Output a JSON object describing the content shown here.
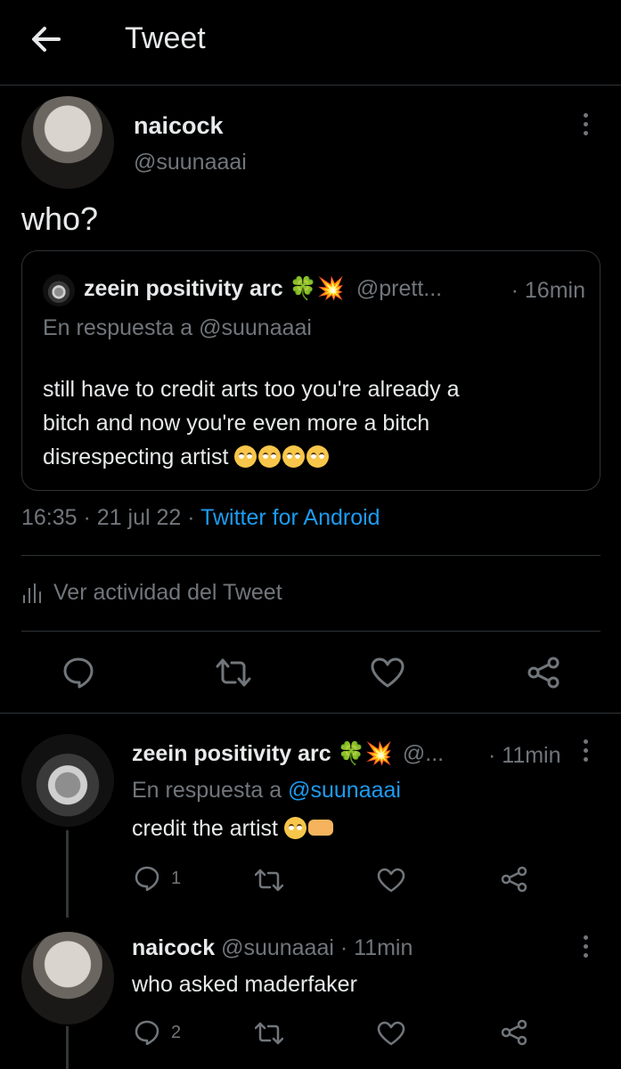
{
  "header": {
    "title": "Tweet"
  },
  "main_tweet": {
    "display_name": "naicock",
    "handle": "@suunaaai",
    "text": "who?",
    "quote": {
      "display_name": "zeein positivity arc",
      "name_emojis": [
        "🍀",
        "💥"
      ],
      "handle": "@prett...",
      "time": "· 16min",
      "reply_prefix": "En respuesta a",
      "reply_handle": "@suunaaai",
      "text_lines": [
        "still have to credit arts too you're already a",
        "bitch and now you're even more a bitch",
        "disrespecting artist"
      ],
      "text_emojis": [
        "🙄",
        "🙄",
        "🙄",
        "🙄"
      ]
    },
    "time": "16:35",
    "date": "21 jul 22",
    "separator": "·",
    "source": "Twitter for Android",
    "activity_label": "Ver actividad del Tweet"
  },
  "replies": [
    {
      "display_name": "zeein positivity arc",
      "name_emojis": [
        "🍀",
        "💥"
      ],
      "handle": "@...",
      "time": "· 11min",
      "reply_prefix": "En respuesta a",
      "reply_handle": "@suunaaai",
      "text": "credit the artist",
      "text_emojis": [
        "🙄",
        "🤝"
      ],
      "reply_count": "1"
    },
    {
      "display_name": "naicock",
      "handle": "@suunaaai",
      "time": "· 11min",
      "text": "who asked maderfaker",
      "reply_count": "2"
    }
  ],
  "colors": {
    "background": "#000000",
    "text": "#e7e9ea",
    "muted": "#71767b",
    "link": "#1d9bf0",
    "border": "#2f3336"
  }
}
